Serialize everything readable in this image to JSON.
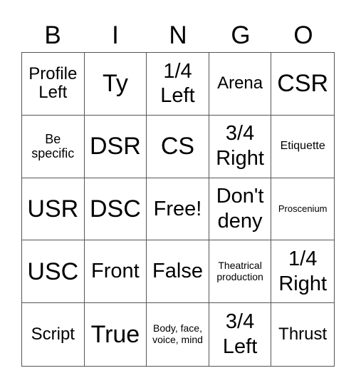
{
  "header": [
    "B",
    "I",
    "N",
    "G",
    "O"
  ],
  "cells": [
    {
      "text": "Profile Left",
      "size": "md"
    },
    {
      "text": "Ty",
      "size": "xl"
    },
    {
      "text": "1/4 Left",
      "size": "lg"
    },
    {
      "text": "Arena",
      "size": "md"
    },
    {
      "text": "CSR",
      "size": "xl"
    },
    {
      "text": "Be specific",
      "size": "sm"
    },
    {
      "text": "DSR",
      "size": "xl"
    },
    {
      "text": "CS",
      "size": "xl"
    },
    {
      "text": "3/4 Right",
      "size": "lg"
    },
    {
      "text": "Etiquette",
      "size": "xs"
    },
    {
      "text": "USR",
      "size": "xl"
    },
    {
      "text": "DSC",
      "size": "xl"
    },
    {
      "text": "Free!",
      "size": "lg"
    },
    {
      "text": "Don't deny",
      "size": "lg"
    },
    {
      "text": "Proscenium",
      "size": "tiny"
    },
    {
      "text": "USC",
      "size": "xl"
    },
    {
      "text": "Front",
      "size": "lg"
    },
    {
      "text": "False",
      "size": "lg"
    },
    {
      "text": "Theatrical production",
      "size": "xxs"
    },
    {
      "text": "1/4 Right",
      "size": "lg"
    },
    {
      "text": "Script",
      "size": "md"
    },
    {
      "text": "True",
      "size": "xl"
    },
    {
      "text": "Body, face, voice, mind",
      "size": "xxs"
    },
    {
      "text": "3/4 Left",
      "size": "lg"
    },
    {
      "text": "Thrust",
      "size": "md"
    }
  ]
}
